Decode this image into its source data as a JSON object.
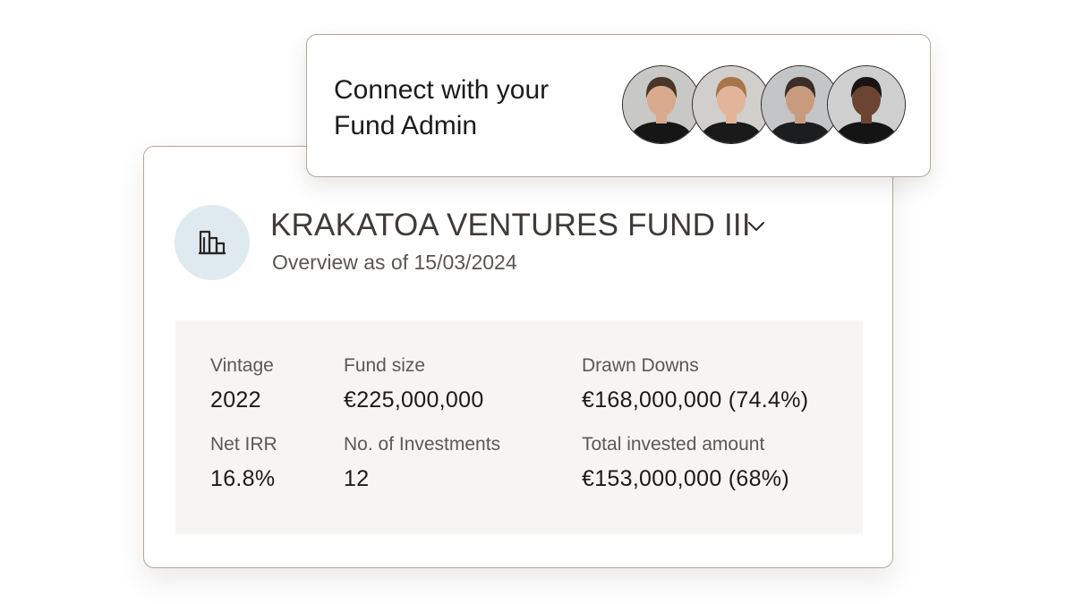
{
  "connect": {
    "title": "Connect with your Fund Admin",
    "avatars": [
      {
        "name": "avatar-1",
        "bg": "#c8c8c6",
        "skin": "#d8a98c",
        "hair": "#4a3628",
        "shirt": "#161616"
      },
      {
        "name": "avatar-2",
        "bg": "#d0cfcc",
        "skin": "#e2b49a",
        "hair": "#a8754a",
        "shirt": "#1a1a1a"
      },
      {
        "name": "avatar-3",
        "bg": "#c4c5c6",
        "skin": "#c99b7e",
        "hair": "#3a2e26",
        "shirt": "#1b1d1f"
      },
      {
        "name": "avatar-4",
        "bg": "#cfcfcf",
        "skin": "#6b4532",
        "hair": "#1a1412",
        "shirt": "#141414"
      }
    ]
  },
  "fund": {
    "icon": "building-chart-icon",
    "title": "KRAKATOA VENTURES FUND III",
    "subtitle": "Overview as of 15/03/2024",
    "stats": [
      {
        "label": "Vintage",
        "value": "2022"
      },
      {
        "label": "Fund size",
        "value": "€225,000,000"
      },
      {
        "label": "Drawn Downs",
        "value": "€168,000,000 (74.4%)"
      },
      {
        "label": "Net IRR",
        "value": "16.8%"
      },
      {
        "label": "No. of Investments",
        "value": "12"
      },
      {
        "label": "Total invested amount",
        "value": "€153,000,000 (68%)"
      }
    ]
  },
  "colors": {
    "icon_circle": "#dfeaf0",
    "panel_bg": "#f6f5f3",
    "card_border": "#b3a79c"
  }
}
